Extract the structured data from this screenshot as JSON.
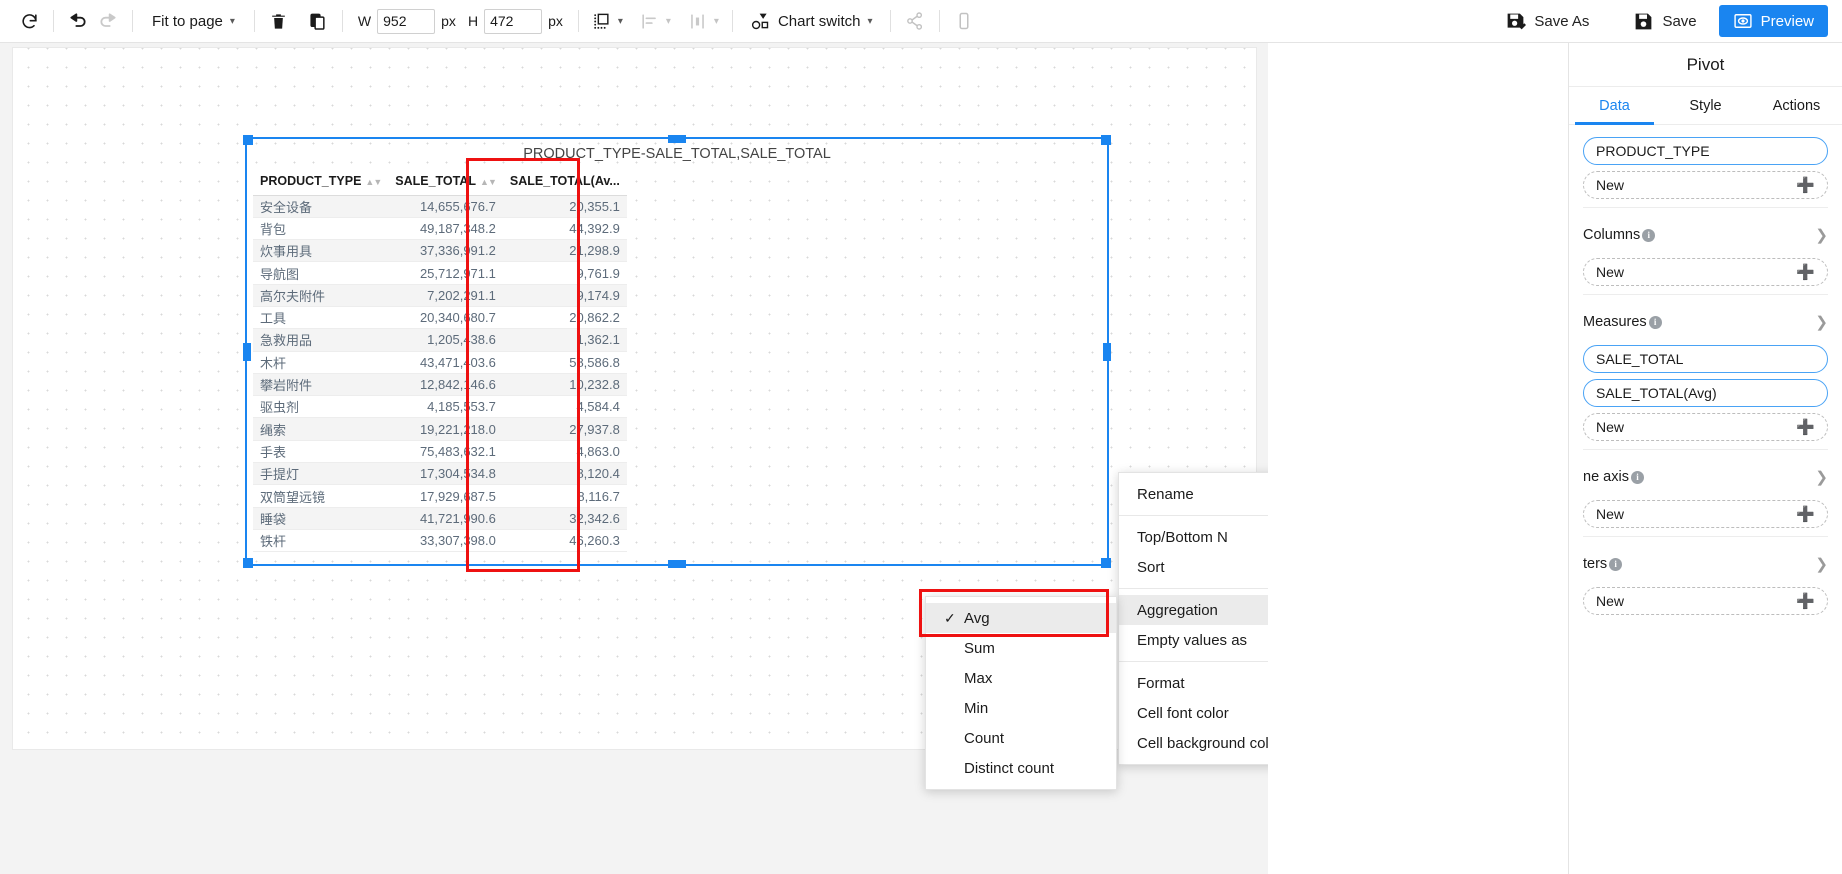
{
  "toolbar": {
    "refresh_icon": "refresh-icon",
    "undo_icon": "undo-icon",
    "redo_icon": "redo-icon",
    "zoom_label": "Fit to page",
    "delete_icon": "trash-icon",
    "copy_icon": "copy-icon",
    "width_label": "W",
    "width_value": "952",
    "px_label_1": "px",
    "height_label": "H",
    "height_value": "472",
    "px_label_2": "px",
    "arrange_icon": "arrange-icon",
    "align_icon": "align-left-icon",
    "distribute_icon": "distribute-icon",
    "chart_switch_label": "Chart switch",
    "share_icon": "share-icon",
    "mobile_icon": "mobile-icon",
    "save_as_label": "Save As",
    "save_label": "Save",
    "preview_label": "Preview",
    "accent_color": "#1a85f0"
  },
  "chart": {
    "title": "PRODUCT_TYPE-SALE_TOTAL,SALE_TOTAL"
  },
  "chart_data": {
    "type": "table",
    "title": "PRODUCT_TYPE-SALE_TOTAL,SALE_TOTAL",
    "columns": [
      "PRODUCT_TYPE",
      "SALE_TOTAL",
      "SALE_TOTAL(Av..."
    ],
    "rows": [
      [
        "安全设备",
        "14,655,676.7",
        "20,355.1"
      ],
      [
        "背包",
        "49,187,348.2",
        "44,392.9"
      ],
      [
        "炊事用具",
        "37,336,991.2",
        "21,298.9"
      ],
      [
        "导航图",
        "25,712,971.1",
        "9,761.9"
      ],
      [
        "高尔夫附件",
        "7,202,291.1",
        "9,174.9"
      ],
      [
        "工具",
        "20,340,680.7",
        "20,862.2"
      ],
      [
        "急救用品",
        "1,205,438.6",
        "1,362.1"
      ],
      [
        "木杆",
        "43,471,403.6",
        "58,586.8"
      ],
      [
        "攀岩附件",
        "12,842,146.6",
        "10,232.8"
      ],
      [
        "驱虫剂",
        "4,185,553.7",
        "4,584.4"
      ],
      [
        "绳索",
        "19,221,218.0",
        "27,937.8"
      ],
      [
        "手表",
        "75,483,632.1",
        "4,863.0"
      ],
      [
        "手提灯",
        "17,304,534.8",
        "8,120.4"
      ],
      [
        "双筒望远镜",
        "17,929,687.5",
        "8,116.7"
      ],
      [
        "睡袋",
        "41,721,990.6",
        "32,342.6"
      ],
      [
        "铁杆",
        "33,307,398.0",
        "46,260.3"
      ]
    ]
  },
  "context_menu": {
    "items": [
      {
        "label": "Rename",
        "submenu": false,
        "active": false,
        "divider_after": true
      },
      {
        "label": "Top/Bottom N",
        "submenu": false,
        "active": false,
        "divider_after": false
      },
      {
        "label": "Sort",
        "submenu": true,
        "active": false,
        "divider_after": true
      },
      {
        "label": "Aggregation",
        "submenu": true,
        "active": true,
        "divider_after": false
      },
      {
        "label": "Empty values as",
        "submenu": false,
        "active": false,
        "divider_after": true
      },
      {
        "label": "Format",
        "submenu": false,
        "active": false,
        "divider_after": false
      },
      {
        "label": "Cell font color",
        "submenu": false,
        "active": false,
        "divider_after": false
      },
      {
        "label": "Cell background color",
        "submenu": false,
        "active": false,
        "divider_after": false
      }
    ]
  },
  "aggregation_menu": {
    "items": [
      {
        "label": "Avg",
        "checked": true
      },
      {
        "label": "Sum",
        "checked": false
      },
      {
        "label": "Max",
        "checked": false
      },
      {
        "label": "Min",
        "checked": false
      },
      {
        "label": "Count",
        "checked": false
      },
      {
        "label": "Distinct count",
        "checked": false
      }
    ]
  },
  "panel": {
    "title": "Pivot",
    "tabs": [
      {
        "label": "Data",
        "selected": true
      },
      {
        "label": "Style",
        "selected": false
      },
      {
        "label": "Actions",
        "selected": false
      }
    ],
    "rows_section": {
      "pills": [
        {
          "label": "PRODUCT_TYPE",
          "type": "solid",
          "plus": false
        },
        {
          "label": "New",
          "type": "dashed",
          "plus": true
        }
      ]
    },
    "columns_section": {
      "title": "Columns",
      "pills": [
        {
          "label": "New",
          "type": "dashed",
          "plus": true
        }
      ]
    },
    "measures_section": {
      "title": "Measures",
      "pills": [
        {
          "label": "SALE_TOTAL",
          "type": "solid",
          "plus": false
        },
        {
          "label": "SALE_TOTAL(Avg)",
          "type": "solid",
          "plus": false
        },
        {
          "label": "New",
          "type": "dashed",
          "plus": true
        }
      ]
    },
    "axis_section": {
      "title": "ne axis",
      "pills": [
        {
          "label": "New",
          "type": "dashed",
          "plus": true
        }
      ]
    },
    "filters_section": {
      "title": "ters",
      "pills": [
        {
          "label": "New",
          "type": "dashed",
          "plus": true
        }
      ]
    }
  }
}
